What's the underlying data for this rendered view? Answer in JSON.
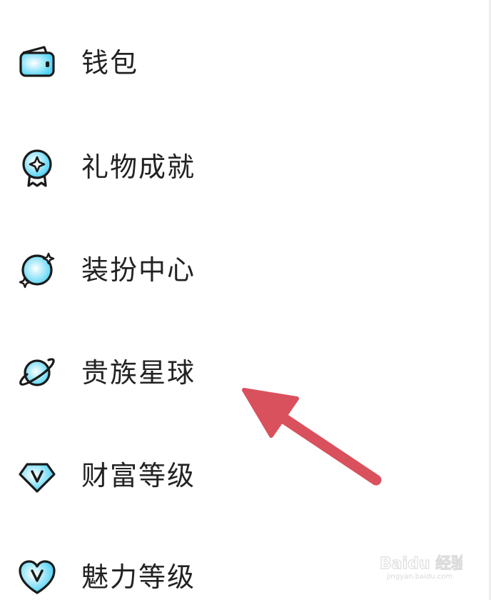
{
  "menu": {
    "items": [
      {
        "label": "钱包",
        "icon": "wallet-icon"
      },
      {
        "label": "礼物成就",
        "icon": "badge-icon"
      },
      {
        "label": "装扮中心",
        "icon": "dress-up-icon"
      },
      {
        "label": "贵族星球",
        "icon": "planet-icon"
      },
      {
        "label": "财富等级",
        "icon": "diamond-v-icon"
      },
      {
        "label": "魅力等级",
        "icon": "heart-v-icon"
      }
    ]
  },
  "annotation": {
    "arrow_color": "#d9515d",
    "points_to": "贵族星球"
  },
  "watermark": {
    "text": "Baidu 经验",
    "subtext": "jingyan.baidu.com"
  },
  "colors": {
    "icon_fill": "#4fd3f5",
    "icon_stroke": "#1a1a1a",
    "label": "#222222"
  }
}
